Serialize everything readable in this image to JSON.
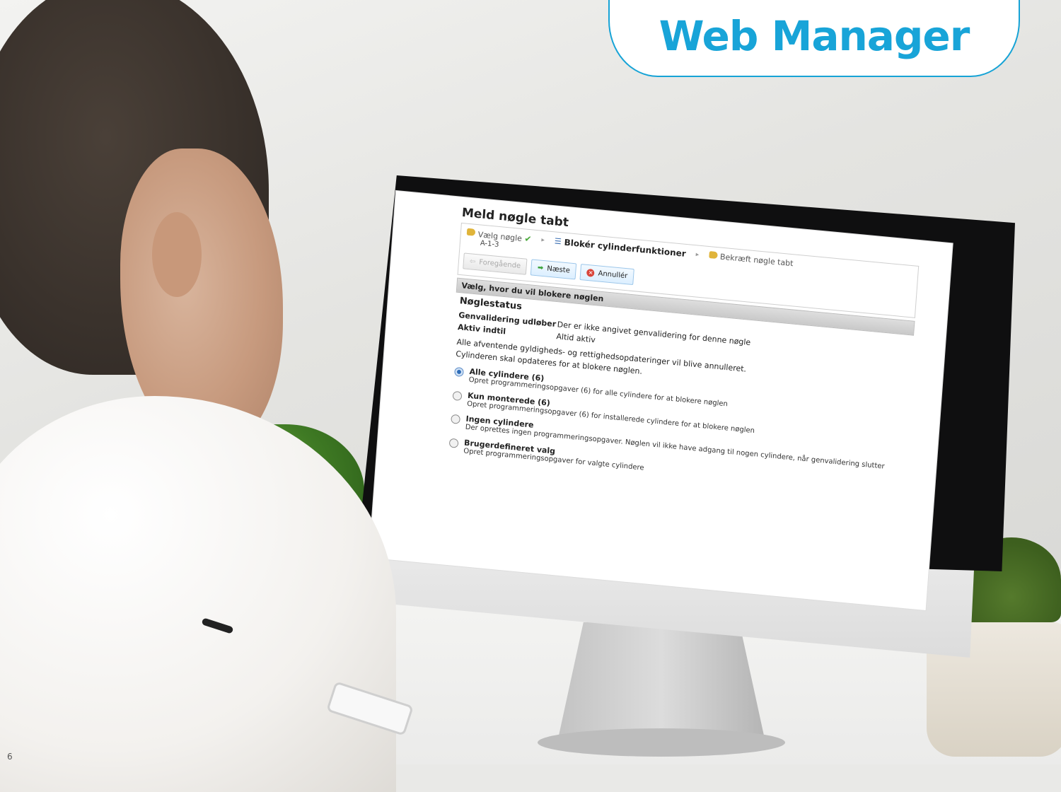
{
  "brand": {
    "badge_text": "Web Manager",
    "accent_color": "#18a4d8"
  },
  "page_number": "6",
  "screen": {
    "title": "Meld nøgle tabt",
    "wizard": {
      "step1_label": "Vælg nøgle",
      "step1_sub": "A-1-3",
      "step2_label": "Blokér cylinderfunktioner",
      "step3_label": "Bekræft nøgle tabt"
    },
    "toolbar": {
      "previous_label": "Foregående",
      "next_label": "Næste",
      "cancel_label": "Annullér"
    },
    "section_header": "Vælg, hvor du vil blokere nøglen",
    "status_title": "Nøglestatus",
    "status": {
      "revalidation_label": "Genvalidering udløber",
      "revalidation_value": "Der er ikke angivet genvalidering for denne nøgle",
      "active_label": "Aktiv indtil",
      "active_value": "Altid aktiv"
    },
    "note1": "Alle afventende gyldigheds- og rettighedsopdateringer vil blive annulleret.",
    "note2": "Cylinderen skal opdateres for at blokere nøglen.",
    "options": [
      {
        "title": "Alle cylindere (6)",
        "desc": "Opret programmeringsopgaver (6) for alle cylindere for at blokere nøglen",
        "selected": true
      },
      {
        "title": "Kun monterede (6)",
        "desc": "Opret programmeringsopgaver (6) for installerede cylindere for at blokere nøglen",
        "selected": false
      },
      {
        "title": "Ingen cylindere",
        "desc": "Der oprettes ingen programmeringsopgaver. Nøglen vil ikke have adgang til nogen cylindere, når genvalidering slutter",
        "selected": false
      },
      {
        "title": "Brugerdefineret valg",
        "desc": "Opret programmeringsopgaver for valgte cylindere",
        "selected": false
      }
    ]
  }
}
